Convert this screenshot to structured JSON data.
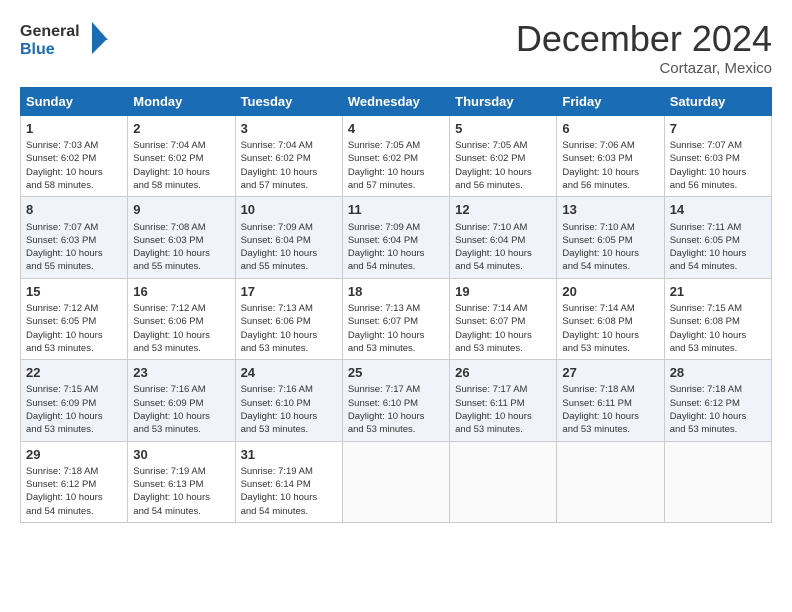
{
  "header": {
    "logo_line1": "General",
    "logo_line2": "Blue",
    "title": "December 2024",
    "location": "Cortazar, Mexico"
  },
  "days_of_week": [
    "Sunday",
    "Monday",
    "Tuesday",
    "Wednesday",
    "Thursday",
    "Friday",
    "Saturday"
  ],
  "weeks": [
    [
      {
        "day": "1",
        "info": "Sunrise: 7:03 AM\nSunset: 6:02 PM\nDaylight: 10 hours\nand 58 minutes."
      },
      {
        "day": "2",
        "info": "Sunrise: 7:04 AM\nSunset: 6:02 PM\nDaylight: 10 hours\nand 58 minutes."
      },
      {
        "day": "3",
        "info": "Sunrise: 7:04 AM\nSunset: 6:02 PM\nDaylight: 10 hours\nand 57 minutes."
      },
      {
        "day": "4",
        "info": "Sunrise: 7:05 AM\nSunset: 6:02 PM\nDaylight: 10 hours\nand 57 minutes."
      },
      {
        "day": "5",
        "info": "Sunrise: 7:05 AM\nSunset: 6:02 PM\nDaylight: 10 hours\nand 56 minutes."
      },
      {
        "day": "6",
        "info": "Sunrise: 7:06 AM\nSunset: 6:03 PM\nDaylight: 10 hours\nand 56 minutes."
      },
      {
        "day": "7",
        "info": "Sunrise: 7:07 AM\nSunset: 6:03 PM\nDaylight: 10 hours\nand 56 minutes."
      }
    ],
    [
      {
        "day": "8",
        "info": "Sunrise: 7:07 AM\nSunset: 6:03 PM\nDaylight: 10 hours\nand 55 minutes."
      },
      {
        "day": "9",
        "info": "Sunrise: 7:08 AM\nSunset: 6:03 PM\nDaylight: 10 hours\nand 55 minutes."
      },
      {
        "day": "10",
        "info": "Sunrise: 7:09 AM\nSunset: 6:04 PM\nDaylight: 10 hours\nand 55 minutes."
      },
      {
        "day": "11",
        "info": "Sunrise: 7:09 AM\nSunset: 6:04 PM\nDaylight: 10 hours\nand 54 minutes."
      },
      {
        "day": "12",
        "info": "Sunrise: 7:10 AM\nSunset: 6:04 PM\nDaylight: 10 hours\nand 54 minutes."
      },
      {
        "day": "13",
        "info": "Sunrise: 7:10 AM\nSunset: 6:05 PM\nDaylight: 10 hours\nand 54 minutes."
      },
      {
        "day": "14",
        "info": "Sunrise: 7:11 AM\nSunset: 6:05 PM\nDaylight: 10 hours\nand 54 minutes."
      }
    ],
    [
      {
        "day": "15",
        "info": "Sunrise: 7:12 AM\nSunset: 6:05 PM\nDaylight: 10 hours\nand 53 minutes."
      },
      {
        "day": "16",
        "info": "Sunrise: 7:12 AM\nSunset: 6:06 PM\nDaylight: 10 hours\nand 53 minutes."
      },
      {
        "day": "17",
        "info": "Sunrise: 7:13 AM\nSunset: 6:06 PM\nDaylight: 10 hours\nand 53 minutes."
      },
      {
        "day": "18",
        "info": "Sunrise: 7:13 AM\nSunset: 6:07 PM\nDaylight: 10 hours\nand 53 minutes."
      },
      {
        "day": "19",
        "info": "Sunrise: 7:14 AM\nSunset: 6:07 PM\nDaylight: 10 hours\nand 53 minutes."
      },
      {
        "day": "20",
        "info": "Sunrise: 7:14 AM\nSunset: 6:08 PM\nDaylight: 10 hours\nand 53 minutes."
      },
      {
        "day": "21",
        "info": "Sunrise: 7:15 AM\nSunset: 6:08 PM\nDaylight: 10 hours\nand 53 minutes."
      }
    ],
    [
      {
        "day": "22",
        "info": "Sunrise: 7:15 AM\nSunset: 6:09 PM\nDaylight: 10 hours\nand 53 minutes."
      },
      {
        "day": "23",
        "info": "Sunrise: 7:16 AM\nSunset: 6:09 PM\nDaylight: 10 hours\nand 53 minutes."
      },
      {
        "day": "24",
        "info": "Sunrise: 7:16 AM\nSunset: 6:10 PM\nDaylight: 10 hours\nand 53 minutes."
      },
      {
        "day": "25",
        "info": "Sunrise: 7:17 AM\nSunset: 6:10 PM\nDaylight: 10 hours\nand 53 minutes."
      },
      {
        "day": "26",
        "info": "Sunrise: 7:17 AM\nSunset: 6:11 PM\nDaylight: 10 hours\nand 53 minutes."
      },
      {
        "day": "27",
        "info": "Sunrise: 7:18 AM\nSunset: 6:11 PM\nDaylight: 10 hours\nand 53 minutes."
      },
      {
        "day": "28",
        "info": "Sunrise: 7:18 AM\nSunset: 6:12 PM\nDaylight: 10 hours\nand 53 minutes."
      }
    ],
    [
      {
        "day": "29",
        "info": "Sunrise: 7:18 AM\nSunset: 6:12 PM\nDaylight: 10 hours\nand 54 minutes."
      },
      {
        "day": "30",
        "info": "Sunrise: 7:19 AM\nSunset: 6:13 PM\nDaylight: 10 hours\nand 54 minutes."
      },
      {
        "day": "31",
        "info": "Sunrise: 7:19 AM\nSunset: 6:14 PM\nDaylight: 10 hours\nand 54 minutes."
      },
      null,
      null,
      null,
      null
    ]
  ]
}
